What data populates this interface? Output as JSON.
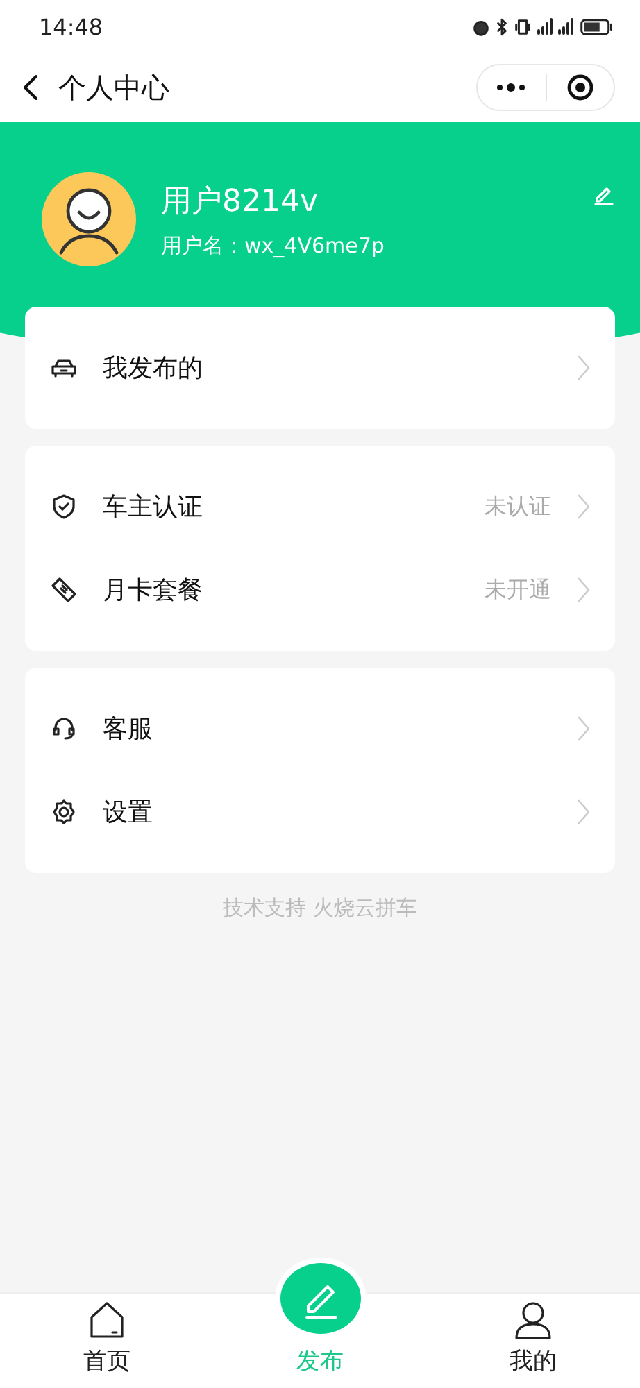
{
  "status_bar": {
    "time": "14:48"
  },
  "nav": {
    "title": "个人中心"
  },
  "profile": {
    "name": "用户8214v",
    "username": "用户名：wx_4V6me7p"
  },
  "groups": [
    {
      "items": [
        {
          "label": "我发布的"
        }
      ]
    },
    {
      "items": [
        {
          "label": "车主认证",
          "value": "未认证"
        },
        {
          "label": "月卡套餐",
          "value": "未开通"
        }
      ]
    },
    {
      "items": [
        {
          "label": "客服"
        },
        {
          "label": "设置"
        }
      ]
    }
  ],
  "footer": "技术支持 火烧云拼车",
  "tab_bar": [
    {
      "label": "首页",
      "kind": "plain",
      "selected": false
    },
    {
      "label": "发布",
      "kind": "center",
      "selected": false
    },
    {
      "label": "我的",
      "kind": "plain",
      "selected": false
    }
  ]
}
